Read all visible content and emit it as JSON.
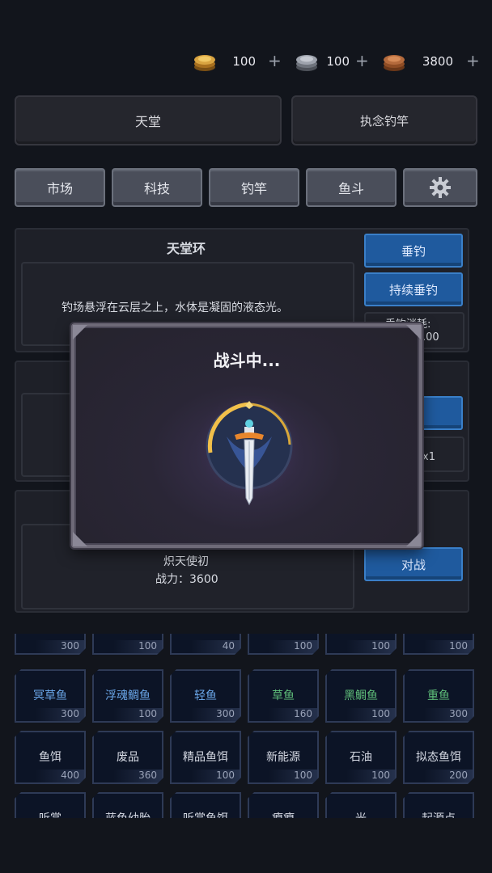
{
  "currencies": [
    {
      "name": "gold-coin-icon",
      "value": "100",
      "plus": "+",
      "color": "#d9a441"
    },
    {
      "name": "silver-coin-icon",
      "value": "100",
      "plus": "+",
      "color": "#9ea3ad"
    },
    {
      "name": "bronze-coin-icon",
      "value": "3800",
      "plus": "+",
      "color": "#b46a3c"
    }
  ],
  "header": {
    "location": "天堂",
    "rod": "执念钓竿"
  },
  "nav": {
    "market": "市场",
    "tech": "科技",
    "rod": "钓竿",
    "fish_fight": "鱼斗",
    "settings_icon": "gear-icon"
  },
  "fishing": {
    "title": "天堂环",
    "desc": "钓场悬浮在云层之上，水体是凝固的液态光。",
    "cast": "垂钓",
    "auto_cast": "持续垂钓",
    "cost_label": "垂钓消耗:",
    "cost_value": ".00"
  },
  "middle": {
    "partial_right": "x1"
  },
  "battle": {
    "enemy_name": "炽天使初",
    "power": "战力：3600",
    "fight_button": "对战"
  },
  "modal": {
    "title": "战斗中...",
    "icon": "sword-shield-icon"
  },
  "inventory": {
    "row0": [
      {
        "count": "300"
      },
      {
        "count": "100"
      },
      {
        "count": "40"
      },
      {
        "count": "100"
      },
      {
        "count": "100"
      },
      {
        "count": "100"
      }
    ],
    "row1": [
      {
        "name": "冥草鱼",
        "count": "300",
        "color": "blue"
      },
      {
        "name": "浮魂鲷鱼",
        "count": "100",
        "color": "blue"
      },
      {
        "name": "轻鱼",
        "count": "300",
        "color": "blue"
      },
      {
        "name": "草鱼",
        "count": "160",
        "color": "green"
      },
      {
        "name": "黑鲷鱼",
        "count": "100",
        "color": "green"
      },
      {
        "name": "重鱼",
        "count": "300",
        "color": "green"
      }
    ],
    "row2": [
      {
        "name": "鱼饵",
        "count": "400",
        "color": "white"
      },
      {
        "name": "废品",
        "count": "360",
        "color": "white"
      },
      {
        "name": "精品鱼饵",
        "count": "100",
        "color": "white"
      },
      {
        "name": "新能源",
        "count": "100",
        "color": "white"
      },
      {
        "name": "石油",
        "count": "100",
        "color": "white"
      },
      {
        "name": "拟态鱼饵",
        "count": "200",
        "color": "white"
      }
    ],
    "row3": [
      {
        "name": "听赏",
        "color": "white"
      },
      {
        "name": "蓝色幼胎",
        "color": "white"
      },
      {
        "name": "听赏鱼饵",
        "color": "white"
      },
      {
        "name": "瘪瘪",
        "color": "white"
      },
      {
        "name": "光",
        "color": "white"
      },
      {
        "name": "起源点",
        "color": "white"
      }
    ]
  }
}
